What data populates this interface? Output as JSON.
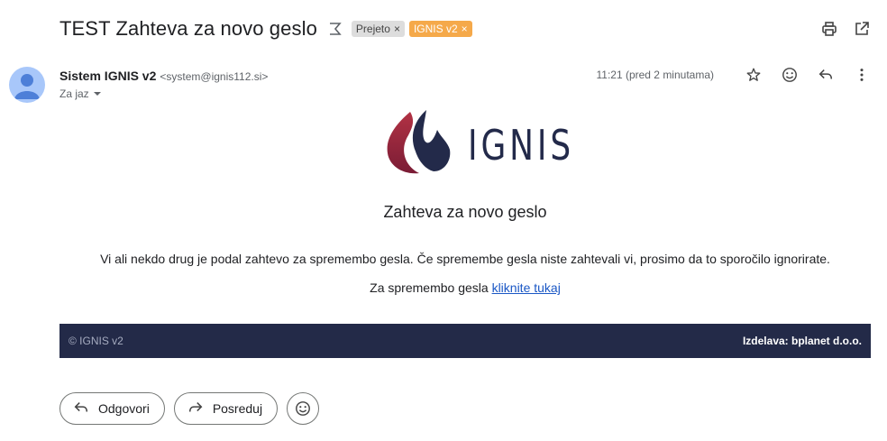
{
  "email": {
    "subject": "TEST Zahteva za novo geslo",
    "labels": [
      {
        "text": "Prejeto",
        "remove": "×"
      },
      {
        "text": "IGNIS v2",
        "remove": "×"
      }
    ],
    "sender_name": "Sistem IGNIS v2",
    "sender_email": "<system@ignis112.si>",
    "to": "Za jaz",
    "time": "11:21 (pred 2 minutama)"
  },
  "content": {
    "logo_text": "IGNIS",
    "heading": "Zahteva za novo geslo",
    "body": "Vi ali nekdo drug je podal zahtevo za spremembo gesla. Če spremembe gesla niste zahtevali vi, prosimo da to sporočilo ignorirate.",
    "link_prefix": "Za spremembo gesla ",
    "link_text": "kliknite tukaj",
    "footer_left": "© IGNIS v2",
    "footer_right": "Izdelava: bplanet d.o.o."
  },
  "actions": {
    "reply": "Odgovori",
    "forward": "Posreduj"
  },
  "colors": {
    "label_orange": "#f5a94a",
    "footer_bg": "#232a48",
    "link": "#1a57c5",
    "avatar": "#a8c7fa"
  },
  "icons": [
    "importance-icon",
    "print-icon",
    "open-new-window-icon",
    "star-icon",
    "emoji-icon",
    "reply-icon",
    "more-vert-icon",
    "dropdown-icon",
    "forward-icon"
  ]
}
